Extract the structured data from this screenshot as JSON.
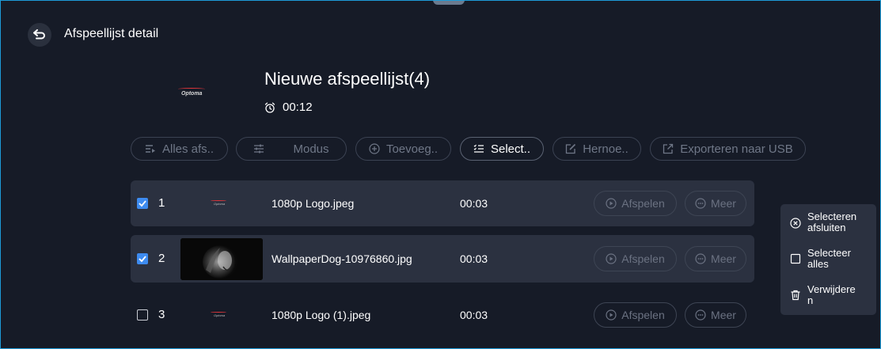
{
  "header": {
    "title": "Afspeellijst detail"
  },
  "playlist": {
    "cover_logo_text": "Optoma",
    "title": "Nieuwe afspeellijst(4)",
    "duration": "00:12"
  },
  "toolbar": {
    "play_all": "Alles afs..",
    "mode": "Modus",
    "add": "Toevoeg..",
    "select": "Select..",
    "rename": "Hernoe..",
    "export": "Exporteren naar USB"
  },
  "items": [
    {
      "index": "1",
      "name": "1080p Logo.jpeg",
      "duration": "00:03",
      "checked": true,
      "thumb_text": "Optoma",
      "play": "Afspelen",
      "more": "Meer"
    },
    {
      "index": "2",
      "name": "WallpaperDog-10976860.jpg",
      "duration": "00:03",
      "checked": true,
      "play": "Afspelen",
      "more": "Meer"
    },
    {
      "index": "3",
      "name": "1080p Logo (1).jpeg",
      "duration": "00:03",
      "checked": false,
      "thumb_text": "Optoma",
      "play": "Afspelen",
      "more": "Meer"
    }
  ],
  "context_menu": {
    "exit_select": "Selecteren\nafsluiten",
    "select_all": "Selecteer\nalles",
    "delete": "Verwijdere\nn"
  },
  "colors": {
    "accent": "#3d8bf0",
    "frame_border": "#1e9bd7",
    "background": "#161b27",
    "row_selected": "#2b3140",
    "logo_red": "#e0353a"
  },
  "icons": {
    "back": "back-arrow-icon",
    "clock": "alarm-clock-icon",
    "play_all": "playlist-play-icon",
    "mode": "sliders-icon",
    "add": "plus-circle-icon",
    "select": "checklist-icon",
    "rename": "edit-icon",
    "export": "export-icon",
    "play": "play-circle-icon",
    "more": "more-circle-icon",
    "exit": "close-circle-icon",
    "select_all": "square-icon",
    "delete": "trash-icon"
  }
}
